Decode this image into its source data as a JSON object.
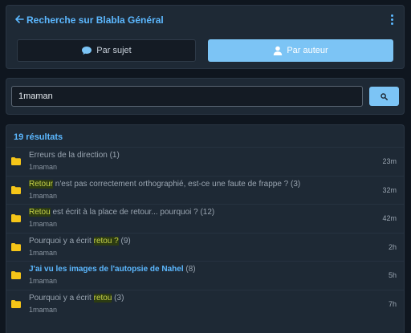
{
  "header": {
    "title": "Recherche sur Blabla Général",
    "tabs": [
      {
        "label": "Par sujet",
        "icon": "speech-bubble-icon"
      },
      {
        "label": "Par auteur",
        "icon": "user-icon"
      }
    ]
  },
  "search": {
    "value": "1maman"
  },
  "results": {
    "count_label": "19 résultats",
    "items": [
      {
        "pre": "Erreurs de la direction",
        "hl": "",
        "post": "",
        "count": " (1)",
        "author": "1maman",
        "time": "23m",
        "bold": false
      },
      {
        "pre": "",
        "hl": "Retour",
        "post": " n'est pas correctement orthographié, est-ce une faute de frappe ?",
        "count": " (3)",
        "author": "1maman",
        "time": "32m",
        "bold": false
      },
      {
        "pre": "",
        "hl": "Retou",
        "post": " est écrit à la place de retour... pourquoi ?",
        "count": " (12)",
        "author": "1maman",
        "time": "42m",
        "bold": false
      },
      {
        "pre": "Pourquoi y a écrit ",
        "hl": "retou ?",
        "post": "",
        "count": " (9)",
        "author": "1maman",
        "time": "2h",
        "bold": false
      },
      {
        "pre": "J'ai vu les images de l'autopsie de Nahel",
        "hl": "",
        "post": "",
        "count": " (8)",
        "author": "1maman",
        "time": "5h",
        "bold": true
      },
      {
        "pre": "Pourquoi y a écrit ",
        "hl": "retou",
        "post": "",
        "count": " (3)",
        "author": "1maman",
        "time": "7h",
        "bold": false
      }
    ]
  },
  "colors": {
    "accent": "#5cb8ff",
    "button": "#7cc4f5",
    "folder": "#f5c518",
    "highlight": "#c8d34a"
  }
}
